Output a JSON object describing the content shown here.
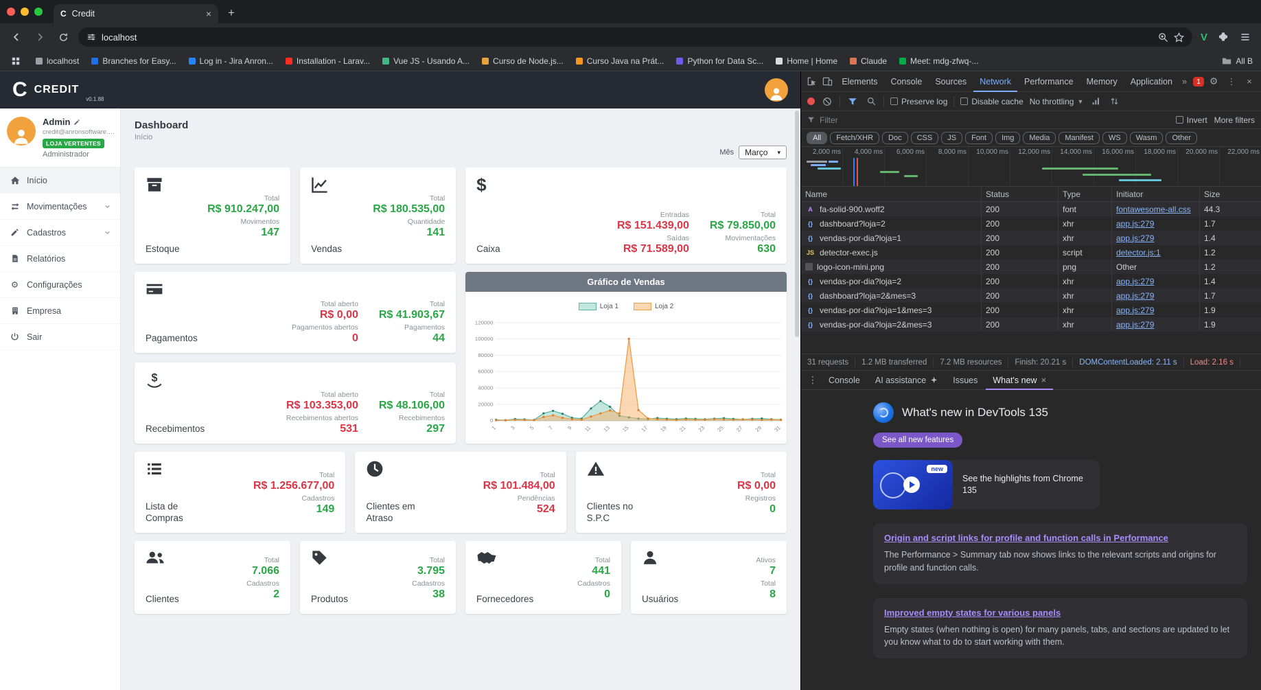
{
  "colors": {
    "positive": "#28a745",
    "negative": "#dc3545",
    "devtools_accent": "#7cacf8",
    "whats_new_accent": "#a78bfa",
    "brand_navbar": "#262b33"
  },
  "browser": {
    "tab_favicon": "C",
    "tab_title": "Credit",
    "new_tab": "+",
    "url": "localhost",
    "bookmarks": [
      {
        "label": "localhost",
        "color": "#9aa0a6"
      },
      {
        "label": "Branches for Easy...",
        "color": "#1f6feb"
      },
      {
        "label": "Log in - Jira Anron...",
        "color": "#2684ff"
      },
      {
        "label": "Installation - Larav...",
        "color": "#ff2d20"
      },
      {
        "label": "Vue JS - Usando A...",
        "color": "#41b883"
      },
      {
        "label": "Curso de Node.js...",
        "color": "#e8a33d"
      },
      {
        "label": "Curso Java na Prát...",
        "color": "#f89820"
      },
      {
        "label": "Python for Data Sc...",
        "color": "#6c5ce7"
      },
      {
        "label": "Home | Home",
        "color": "#dadce0"
      },
      {
        "label": "Claude",
        "color": "#d97757"
      },
      {
        "label": "Meet: mdg-zfwq-...",
        "color": "#00ac47"
      }
    ],
    "all_bookmarks_label": "All B"
  },
  "app": {
    "navbar": {
      "logo": "C",
      "brand": "CREDIT",
      "version": "v0.1.88"
    },
    "user": {
      "name": "Admin",
      "email": "credit@anronsoftware.co...",
      "badge": "LOJA VERTENTES",
      "role": "Administrador"
    },
    "sidebar": {
      "inicio": "Início",
      "movimentacoes": "Movimentações",
      "cadastros": "Cadastros",
      "relatorios": "Relatórios",
      "configuracoes": "Configurações",
      "empresa": "Empresa",
      "sair": "Sair"
    },
    "header": {
      "title": "Dashboard",
      "subtitle": "Início",
      "month_label": "Mês",
      "month_value": "Março"
    },
    "cards": {
      "estoque": {
        "title": "Estoque",
        "stats": [
          {
            "label": "Total",
            "value": "R$ 910.247,00"
          },
          {
            "label": "Movimentos",
            "value": "147"
          }
        ]
      },
      "vendas": {
        "title": "Vendas",
        "stats": [
          {
            "label": "Total",
            "value": "R$ 180.535,00"
          },
          {
            "label": "Quantidade",
            "value": "141"
          }
        ]
      },
      "caixa": {
        "title": "Caixa",
        "stats": [
          {
            "label": "Entradas",
            "value": "R$ 151.439,00"
          },
          {
            "label": "Saídas",
            "value": "R$ 71.589,00"
          },
          {
            "label": "Total",
            "value": "R$ 79.850,00"
          },
          {
            "label": "Movimentações",
            "value": "630"
          }
        ]
      },
      "pagamentos": {
        "title": "Pagamentos",
        "stats": [
          {
            "label": "Total aberto",
            "value": "R$ 0,00"
          },
          {
            "label": "Pagamentos abertos",
            "value": "0"
          },
          {
            "label": "Total",
            "value": "R$ 41.903,67"
          },
          {
            "label": "Pagamentos",
            "value": "44"
          }
        ]
      },
      "recebimentos": {
        "title": "Recebimentos",
        "stats": [
          {
            "label": "Total aberto",
            "value": "R$ 103.353,00"
          },
          {
            "label": "Recebimentos abertos",
            "value": "531"
          },
          {
            "label": "Total",
            "value": "R$ 48.106,00"
          },
          {
            "label": "Recebimentos",
            "value": "297"
          }
        ]
      },
      "lista_compras": {
        "title": "Lista de Compras",
        "stats": [
          {
            "label": "Total",
            "value": "R$ 1.256.677,00"
          },
          {
            "label": "Cadastros",
            "value": "149"
          }
        ]
      },
      "clientes_atraso": {
        "title": "Clientes em Atraso",
        "stats": [
          {
            "label": "Total",
            "value": "R$ 101.484,00"
          },
          {
            "label": "Pendências",
            "value": "524"
          }
        ]
      },
      "clientes_spc": {
        "title": "Clientes no S.P.C",
        "stats": [
          {
            "label": "Total",
            "value": "R$ 0,00"
          },
          {
            "label": "Registros",
            "value": "0"
          }
        ]
      },
      "clientes": {
        "title": "Clientes",
        "stats": [
          {
            "label": "Total",
            "value": "7.066"
          },
          {
            "label": "Cadastros",
            "value": "2"
          }
        ]
      },
      "produtos": {
        "title": "Produtos",
        "stats": [
          {
            "label": "Total",
            "value": "3.795"
          },
          {
            "label": "Cadastros",
            "value": "38"
          }
        ]
      },
      "fornecedores": {
        "title": "Fornecedores",
        "stats": [
          {
            "label": "Total",
            "value": "441"
          },
          {
            "label": "Cadastros",
            "value": "0"
          }
        ]
      },
      "usuarios": {
        "title": "Usuários",
        "stats": [
          {
            "label": "Ativos",
            "value": "7"
          },
          {
            "label": "Total",
            "value": "8"
          }
        ]
      }
    }
  },
  "chart_data": {
    "type": "area",
    "title": "Gráfico de Vendas",
    "x": [
      1,
      2,
      3,
      4,
      5,
      6,
      7,
      8,
      9,
      10,
      11,
      12,
      13,
      14,
      15,
      16,
      17,
      18,
      19,
      20,
      21,
      22,
      23,
      24,
      25,
      26,
      27,
      28,
      29,
      30,
      31
    ],
    "series": [
      {
        "name": "Loja 1",
        "color": "#5bb8a5",
        "fill": "rgba(122,199,182,0.45)",
        "dot": "#2e7d62",
        "values": [
          1000,
          600,
          2000,
          1500,
          900,
          9000,
          12000,
          8500,
          3500,
          2500,
          15000,
          24000,
          17000,
          6000,
          4000,
          2500,
          2000,
          3200,
          2400,
          1800,
          2600,
          2200,
          1700,
          2500,
          3000,
          2100,
          1600,
          2200,
          2600,
          1700,
          1200
        ]
      },
      {
        "name": "Loja 2",
        "color": "#f09f4d",
        "fill": "rgba(247,178,103,0.5)",
        "dot": "#d9822b",
        "values": [
          500,
          400,
          1200,
          900,
          600,
          4500,
          6500,
          3500,
          1800,
          1200,
          5000,
          9000,
          12500,
          9000,
          100000,
          13000,
          2800,
          1800,
          1200,
          900,
          1600,
          1300,
          1100,
          1900,
          1600,
          1100,
          1600,
          1300,
          900,
          1300,
          900
        ]
      }
    ],
    "ylim": [
      0,
      120000
    ],
    "yticks": [
      0,
      20000,
      40000,
      60000,
      80000,
      100000,
      120000
    ],
    "xlabel": "",
    "ylabel": "",
    "legend_position": "top",
    "grid": true
  },
  "devtools": {
    "tabs": [
      "Elements",
      "Console",
      "Sources",
      "Network",
      "Performance",
      "Memory",
      "Application"
    ],
    "active_tab": "Network",
    "more_tabs_symbol": "»",
    "error_badge": "1",
    "settings_symbol": "⚙",
    "toolbar": {
      "preserve_log": "Preserve log",
      "disable_cache": "Disable cache",
      "throttling": "No throttling"
    },
    "filter": {
      "placeholder": "Filter",
      "invert": "Invert",
      "more": "More filters"
    },
    "chips": [
      "All",
      "Fetch/XHR",
      "Doc",
      "CSS",
      "JS",
      "Font",
      "Img",
      "Media",
      "Manifest",
      "WS",
      "Wasm",
      "Other"
    ],
    "active_chip": "All",
    "timeline_ticks": [
      "2,000 ms",
      "4,000 ms",
      "6,000 ms",
      "8,000 ms",
      "10,000 ms",
      "12,000 ms",
      "14,000 ms",
      "16,000 ms",
      "18,000 ms",
      "20,000 ms",
      "22,000 ms"
    ],
    "table": {
      "headers": [
        "Name",
        "Status",
        "Type",
        "Initiator",
        "Size"
      ],
      "rows": [
        {
          "name": "fa-solid-900.woff2",
          "status": "200",
          "type": "font",
          "initiator": "fontawesome-all.css",
          "size": "44.3",
          "icon": "font"
        },
        {
          "name": "dashboard?loja=2",
          "status": "200",
          "type": "xhr",
          "initiator": "app.js:279",
          "size": "1.7",
          "icon": "xhr"
        },
        {
          "name": "vendas-por-dia?loja=1",
          "status": "200",
          "type": "xhr",
          "initiator": "app.js:279",
          "size": "1.4",
          "icon": "xhr"
        },
        {
          "name": "detector-exec.js",
          "status": "200",
          "type": "script",
          "initiator": "detector.js:1",
          "size": "1.2",
          "icon": "script"
        },
        {
          "name": "logo-icon-mini.png",
          "status": "200",
          "type": "png",
          "initiator": "Other",
          "size": "1.2",
          "icon": "img"
        },
        {
          "name": "vendas-por-dia?loja=2",
          "status": "200",
          "type": "xhr",
          "initiator": "app.js:279",
          "size": "1.4",
          "icon": "xhr"
        },
        {
          "name": "dashboard?loja=2&mes=3",
          "status": "200",
          "type": "xhr",
          "initiator": "app.js:279",
          "size": "1.7",
          "icon": "xhr"
        },
        {
          "name": "vendas-por-dia?loja=1&mes=3",
          "status": "200",
          "type": "xhr",
          "initiator": "app.js:279",
          "size": "1.9",
          "icon": "xhr"
        },
        {
          "name": "vendas-por-dia?loja=2&mes=3",
          "status": "200",
          "type": "xhr",
          "initiator": "app.js:279",
          "size": "1.9",
          "icon": "xhr"
        }
      ]
    },
    "summary": {
      "requests": "31 requests",
      "transferred": "1.2 MB transferred",
      "resources": "7.2 MB resources",
      "finish": "Finish: 20.21 s",
      "dcl": "DOMContentLoaded: 2.11 s",
      "load": "Load: 2.16 s"
    },
    "drawer_tabs": {
      "console": "Console",
      "ai": "AI assistance",
      "issues": "Issues",
      "whats_new": "What's new"
    },
    "whats_new": {
      "title": "What's new in DevTools 135",
      "button": "See all new features",
      "video_badge": "new",
      "video_caption": "See the highlights from Chrome 135",
      "sections": [
        {
          "heading": "Origin and script links for profile and function calls in Performance",
          "body": "The Performance > Summary tab now shows links to the relevant scripts and origins for profile and function calls."
        },
        {
          "heading": "Improved empty states for various panels",
          "body": "Empty states (when nothing is open) for many panels, tabs, and sections are updated to let you know what to do to start working with them."
        }
      ]
    }
  }
}
